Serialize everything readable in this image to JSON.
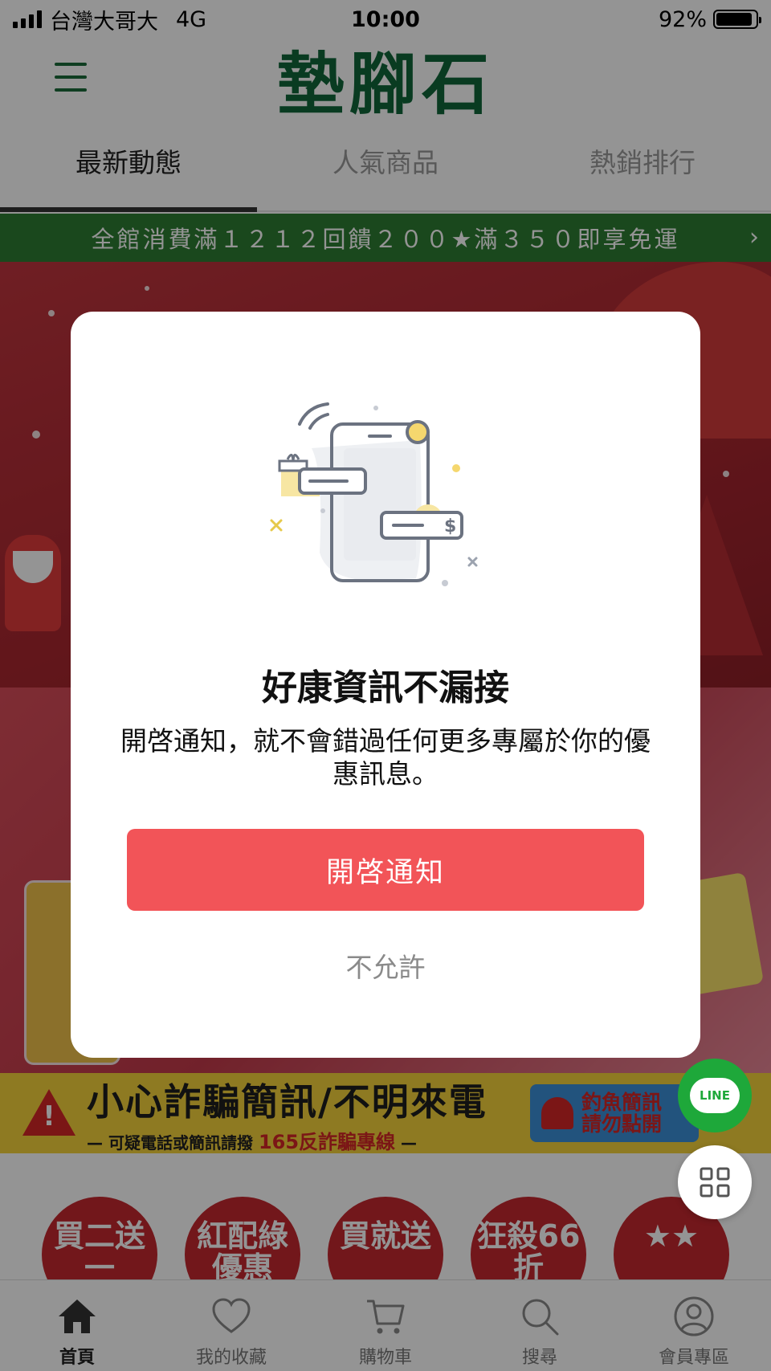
{
  "status_bar": {
    "carrier": "台灣大哥大",
    "network": "4G",
    "time": "10:00",
    "battery_percent_label": "92%",
    "battery_level": 0.92
  },
  "header": {
    "logo_text": "墊腳石",
    "menu_icon": "hamburger-menu-icon"
  },
  "tabs": [
    {
      "label": "最新動態",
      "active": true
    },
    {
      "label": "人氣商品",
      "active": false
    },
    {
      "label": "熱銷排行",
      "active": false
    }
  ],
  "promo_strip": {
    "text": "全館消費滿１２１２回饋２００★滿３５０即享免運",
    "chevron": "›"
  },
  "scam_banner": {
    "title": "小心詐騙簡訊/不明來電",
    "subtitle_prefix": "— 可疑電話或簡訊請撥",
    "hotline": "165反詐騙專線",
    "subtitle_suffix": "—",
    "right_text_line1": "釣魚簡訊",
    "right_text_line2": "請勿點開"
  },
  "shortcuts": [
    {
      "label": "買二送一"
    },
    {
      "label": "紅配綠優惠"
    },
    {
      "label": "買就送"
    },
    {
      "label": "狂殺66折"
    },
    {
      "label": "★★"
    }
  ],
  "bottom_nav": [
    {
      "label": "首頁",
      "icon": "home-icon",
      "active": true
    },
    {
      "label": "我的收藏",
      "icon": "heart-icon",
      "active": false
    },
    {
      "label": "購物車",
      "icon": "cart-icon",
      "active": false
    },
    {
      "label": "搜尋",
      "icon": "search-icon",
      "active": false
    },
    {
      "label": "會員專區",
      "icon": "user-icon",
      "active": false
    }
  ],
  "line_fab": {
    "label": "LINE"
  },
  "modal": {
    "title": "好康資訊不漏接",
    "body": "開啓通知，就不會錯過任何更多專屬於你的優惠訊息。",
    "primary_button": "開啓通知",
    "secondary_button": "不允許",
    "illustration_icon": "phone-notification-illustration"
  },
  "colors": {
    "brand_green": "#11673a",
    "promo_green": "#2e7d32",
    "primary_button": "#f25458",
    "shortcut_red": "#c5282f",
    "line_green": "#1ea83a"
  }
}
